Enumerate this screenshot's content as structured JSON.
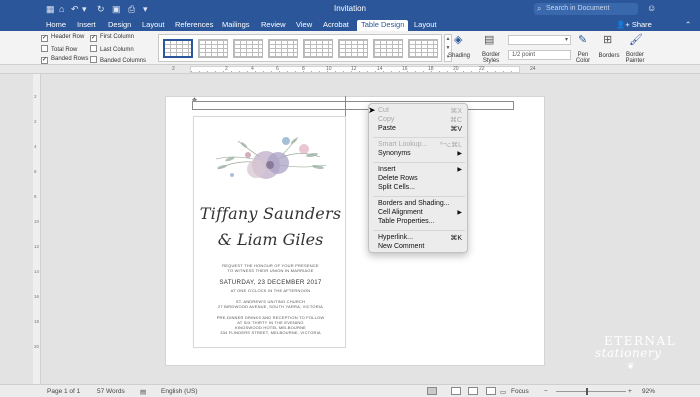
{
  "titlebar": {
    "title": "Invitation",
    "search_placeholder": "Search in Document",
    "quick_access": [
      "grid-icon",
      "home-icon",
      "undo-icon",
      "redo-icon",
      "save-icon",
      "print-icon",
      "more-icon"
    ]
  },
  "tabs": [
    "Home",
    "Insert",
    "Design",
    "Layout",
    "References",
    "Mailings",
    "Review",
    "View",
    "Acrobat",
    "Table Design",
    "Layout"
  ],
  "active_tab": "Table Design",
  "share_label": "Share",
  "style_options": [
    {
      "label": "Header Row",
      "checked": true
    },
    {
      "label": "First Column",
      "checked": true
    },
    {
      "label": "Total Row",
      "checked": false
    },
    {
      "label": "Last Column",
      "checked": false
    },
    {
      "label": "Banded Rows",
      "checked": true
    },
    {
      "label": "Banded Columns",
      "checked": false
    }
  ],
  "ribbon_right": {
    "shading": "Shading",
    "border_styles": "Border Styles",
    "line_weight": "1/2 point",
    "pen_color": "Pen Color",
    "borders": "Borders",
    "border_painter": "Border Painter"
  },
  "ruler_numbers": [
    "2",
    "2",
    "4",
    "6",
    "8",
    "10",
    "12",
    "14",
    "16",
    "18",
    "20",
    "22",
    "24"
  ],
  "invitation": {
    "name1": "Tiffany Saunders",
    "name2": "& Liam Giles",
    "request1": "REQUEST THE HONOUR OF YOUR PRESENCE",
    "request2": "TO WITNESS THEIR UNION IN MARRIAGE",
    "date": "SATURDAY, 23 DECEMBER 2017",
    "time": "AT ONE O'CLOCK IN THE AFTERNOON",
    "church1": "ST. ANDREW'S UNITING CHURCH",
    "church2": "27 BIRDWOOD AVENUE, SOUTH YARRA, VICTORIA",
    "reception1": "PRE-DINNER DRINKS AND RECEPTION TO FOLLOW",
    "reception2": "AT SIX THIRTY IN THE EVENING",
    "reception3": "KINGSWOOD HOTEL MELBOURNE",
    "reception4": "334 FLINDERS STREET, MELBOURNE, VICTORIA"
  },
  "context_menu": {
    "cut": "Cut",
    "cut_sc": "⌘X",
    "copy": "Copy",
    "copy_sc": "⌘C",
    "paste": "Paste",
    "paste_sc": "⌘V",
    "smart_lookup": "Smart Lookup...",
    "smart_sc": "^⌥⌘L",
    "synonyms": "Synonyms",
    "insert": "Insert",
    "delete_rows": "Delete Rows",
    "split_cells": "Split Cells...",
    "borders_shading": "Borders and Shading...",
    "cell_alignment": "Cell Alignment",
    "table_properties": "Table Properties...",
    "hyperlink": "Hyperlink...",
    "hyperlink_sc": "⌘K",
    "new_comment": "New Comment"
  },
  "watermark": {
    "line1": "ETERNAL",
    "line2": "stationery"
  },
  "status": {
    "page": "Page 1 of 1",
    "words": "57 Words",
    "language": "English (US)",
    "focus": "Focus",
    "zoom": "92%"
  }
}
